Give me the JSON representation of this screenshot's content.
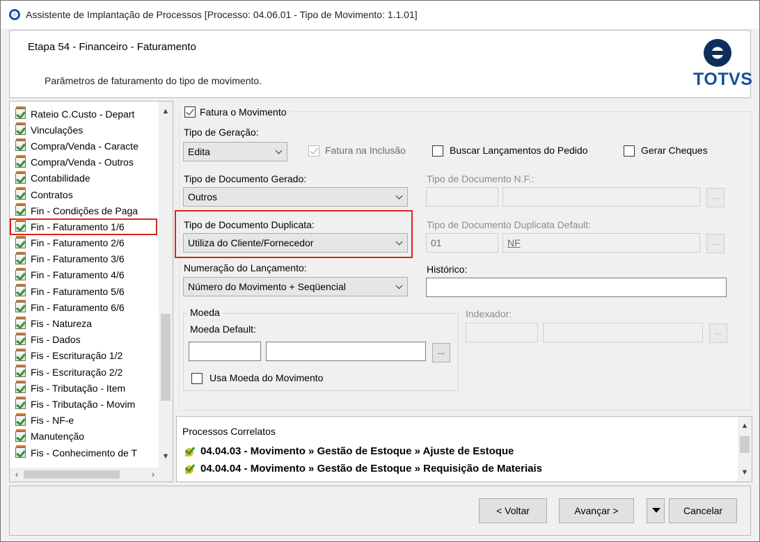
{
  "window": {
    "title": "Assistente de Implantação de Processos [Processo: 04.06.01 - Tipo de Movimento: 1.1.01]"
  },
  "header": {
    "step_title": "Etapa 54 - Financeiro - Faturamento",
    "description": "Parâmetros de faturamento do tipo de movimento.",
    "logo_text": "TOTVS"
  },
  "tree": {
    "items": [
      "Rateio C.Custo - Depart",
      "Vinculações",
      "Compra/Venda - Caracte",
      "Compra/Venda - Outros",
      "Contabilidade",
      "Contratos",
      "Fin - Condições de Paga",
      "Fin - Faturamento 1/6",
      "Fin - Faturamento 2/6",
      "Fin - Faturamento 3/6",
      "Fin - Faturamento 4/6",
      "Fin - Faturamento 5/6",
      "Fin - Faturamento 6/6",
      "Fis - Natureza",
      "Fis - Dados",
      "Fis - Escrituração 1/2",
      "Fis - Escrituração 2/2",
      "Fis - Tributação - Item",
      "Fis - Tributação - Movim",
      "Fis - NF-e",
      "Manutenção",
      "Fis - Conhecimento de T"
    ],
    "selected_index": 7
  },
  "form": {
    "fatura_movimento_label": "Fatura o Movimento",
    "tipo_geracao_label": "Tipo de Geração:",
    "tipo_geracao_value": "Edita",
    "fatura_inclusao_label": "Fatura na Inclusão",
    "buscar_lancamentos_label": "Buscar Lançamentos do Pedido",
    "gerar_cheques_label": "Gerar Cheques",
    "tipo_doc_gerado_label": "Tipo de Documento Gerado:",
    "tipo_doc_gerado_value": "Outros",
    "tipo_doc_nf_label": "Tipo de Documento N.F.:",
    "tipo_doc_dup_label": "Tipo de Documento Duplicata:",
    "tipo_doc_dup_value": "Utiliza do Cliente/Fornecedor",
    "tipo_doc_dup_default_label": "Tipo de Documento Duplicata Default:",
    "tipo_doc_dup_default_code": "01",
    "tipo_doc_dup_default_name": "NF",
    "numeracao_label": "Numeração do Lançamento:",
    "numeracao_value": "Número do Movimento + Seqüencial",
    "historico_label": "Histórico:",
    "moeda_group_label": "Moeda",
    "moeda_default_label": "Moeda Default:",
    "usa_moeda_label": "Usa Moeda do Movimento",
    "indexador_label": "Indexador:",
    "dots_label": "..."
  },
  "correlatos": {
    "title": "Processos Correlatos",
    "items": [
      "04.04.03 - Movimento » Gestão de Estoque » Ajuste de Estoque",
      "04.04.04 - Movimento » Gestão de Estoque » Requisição de Materiais"
    ]
  },
  "buttons": {
    "voltar": "< Voltar",
    "avancar": "Avançar >",
    "cancelar": "Cancelar"
  }
}
